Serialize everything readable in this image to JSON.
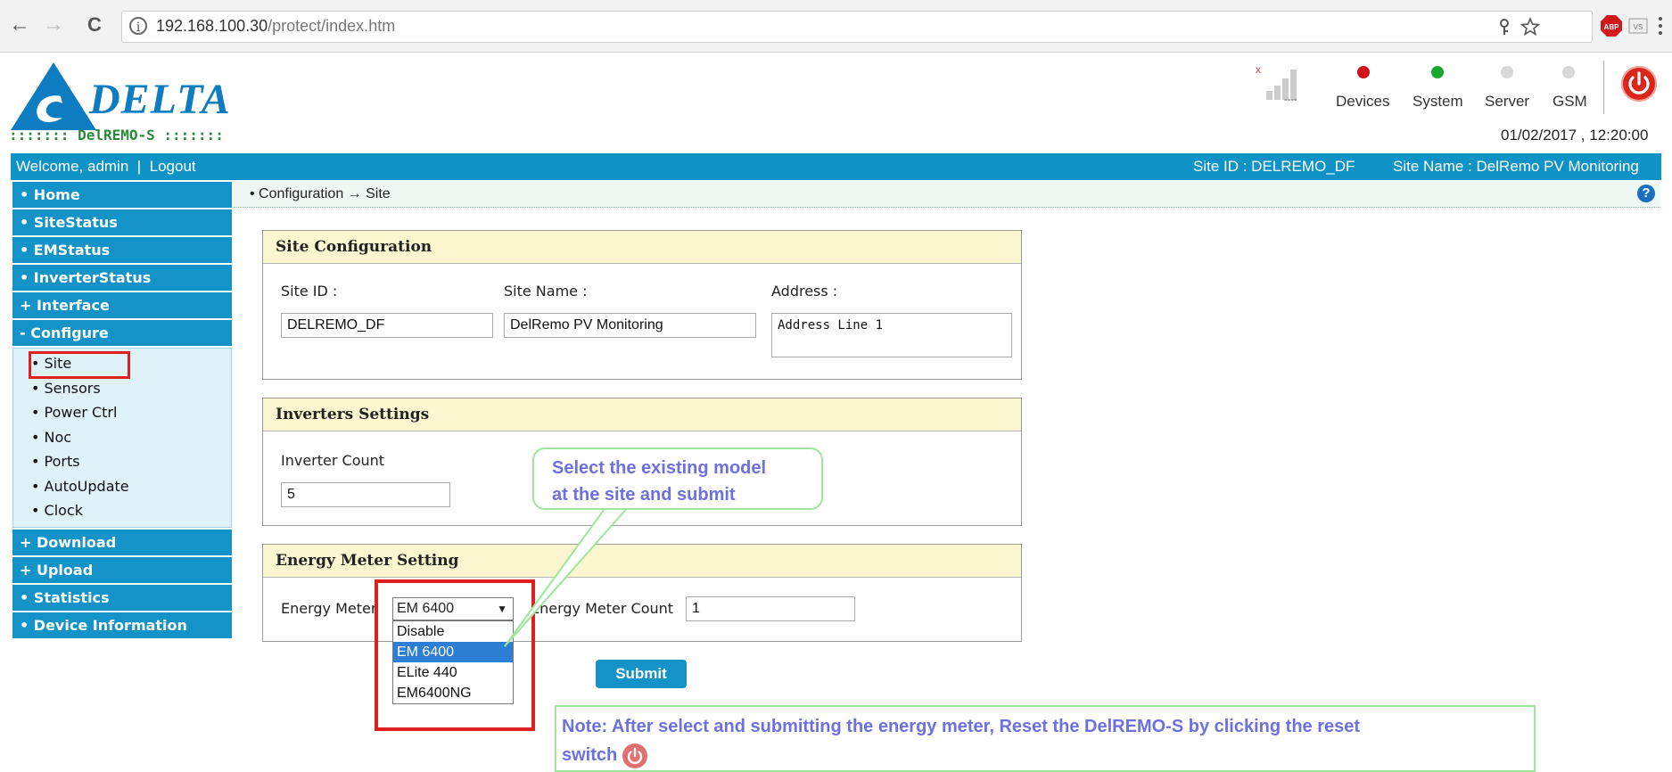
{
  "browser": {
    "url_host": "192.168.100.30",
    "url_path": "/protect/index.htm",
    "back_icon": "←",
    "forward_icon": "→",
    "reload_icon": "C",
    "info_icon": "i"
  },
  "header": {
    "logo_text": "DELTA",
    "logo_sub": "::::::: DelREMO-S :::::::",
    "signal_label": "----",
    "status": [
      {
        "label": "Devices",
        "color": "#d0121b"
      },
      {
        "label": "System",
        "color": "#18a82e"
      },
      {
        "label": "Server",
        "color": "#d8d8d8"
      },
      {
        "label": "GSM",
        "color": "#d8d8d8"
      }
    ],
    "datetime": "01/02/2017 , 12:20:00"
  },
  "bar": {
    "welcome": "Welcome, admin",
    "separator": "|",
    "logout": "Logout",
    "site_id": "Site ID : DELREMO_DF",
    "site_name": "Site Name : DelRemo PV Monitoring"
  },
  "breadcrumb": "• Configuration → Site",
  "sidebar": {
    "items_top": [
      "• Home",
      "• SiteStatus",
      "• EMStatus",
      "• InverterStatus",
      "+ Interface",
      "- Configure"
    ],
    "configure_sub": [
      "• Site",
      "• Sensors",
      "• Power Ctrl",
      "• Noc",
      "• Ports",
      "• AutoUpdate",
      "• Clock"
    ],
    "items_bottom": [
      "+ Download",
      "+ Upload",
      "• Statistics",
      "• Device Information"
    ]
  },
  "site_config": {
    "title": "Site Configuration",
    "site_id_label": "Site ID :",
    "site_id_value": "DELREMO_DF",
    "site_name_label": "Site Name :",
    "site_name_value": "DelRemo PV Monitoring",
    "address_label": "Address :",
    "address_value": "Address Line 1"
  },
  "inverters": {
    "title": "Inverters Settings",
    "count_label": "Inverter Count",
    "count_value": "5"
  },
  "energy_meter": {
    "title": "Energy Meter Setting",
    "meter_label": "Energy Meter",
    "selected": "EM 6400",
    "options": [
      "Disable",
      "EM 6400",
      "ELite 440",
      "EM6400NG"
    ],
    "count_label": "Energy Meter Count",
    "count_value": "1"
  },
  "submit_label": "Submit",
  "callout": {
    "line1": "Select the existing model",
    "line2": "at the site and submit"
  },
  "note": {
    "line1": "Note: After select and submitting the energy meter, Reset the DelREMO-S by clicking the reset",
    "line2": "switch"
  }
}
